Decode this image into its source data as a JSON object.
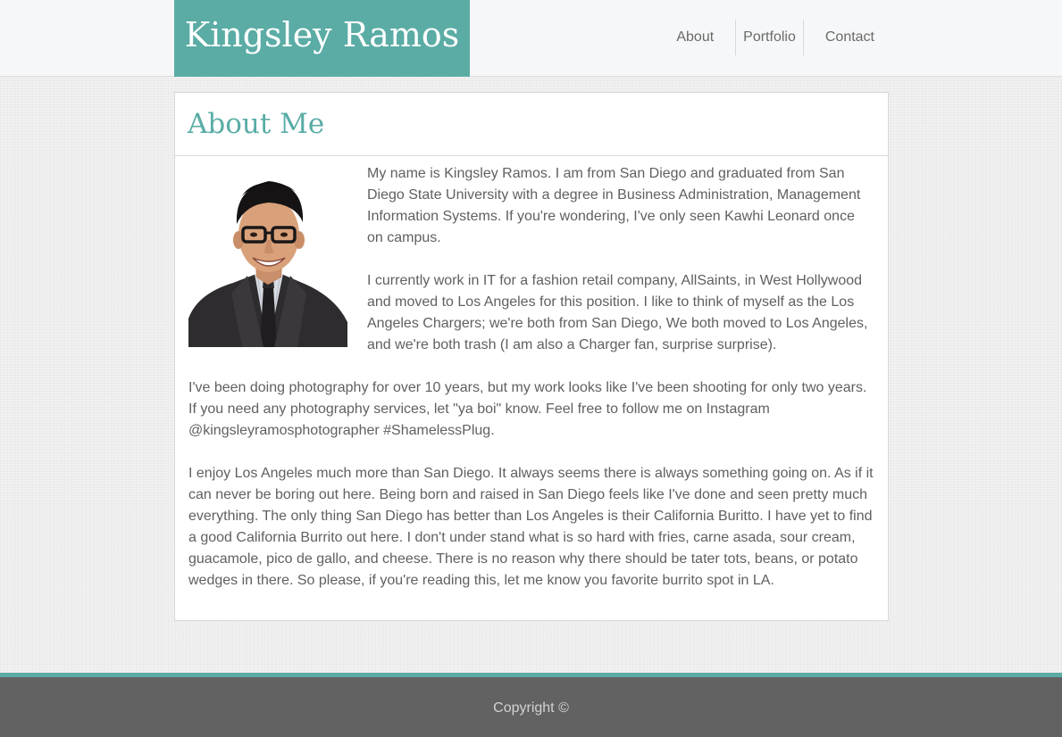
{
  "header": {
    "brand": "Kingsley Ramos",
    "nav": {
      "about": "About",
      "portfolio": "Portfolio",
      "contact": "Contact"
    }
  },
  "main": {
    "title": "About Me",
    "photo_icon": "person-portrait",
    "paragraphs": [
      "My name is Kingsley Ramos. I am from San Diego and graduated from San Diego State University with a degree in Business Administration, Management Information Systems. If you're wondering, I've only seen Kawhi Leonard once on campus.",
      "I currently work in IT for a fashion retail company, AllSaints, in West Hollywood and moved to Los Angeles for this position. I like to think of myself as the Los Angeles Chargers; we're both from San Diego, We both moved to Los Angeles, and we're both trash (I am also a Charger fan, surprise surprise).",
      "I've been doing photography for over 10 years, but my work looks like I've been shooting for only two years. If you need any photography services, let \"ya boi\" know. Feel free to follow me on Instagram @kingsleyramosphotographer #ShamelessPlug.",
      "I enjoy Los Angeles much more than San Diego. It always seems there is always something going on. As if it can never be boring out here. Being born and raised in San Diego feels like I've done and seen pretty much everything. The only thing San Diego has better than Los Angeles is their California Buritto. I have yet to find a good California Burrito out here. I don't under stand what is so hard with fries, carne asada, sour cream, guacamole, pico de gallo, and cheese. There is no reason why there should be tater tots, beans, or potato wedges in there. So please, if you're reading this, let me know you favorite burrito spot in LA."
    ]
  },
  "footer": {
    "copyright": "Copyright ©"
  },
  "colors": {
    "accent": "#5aaca5",
    "footer_bg": "#626262",
    "text": "#606060"
  }
}
